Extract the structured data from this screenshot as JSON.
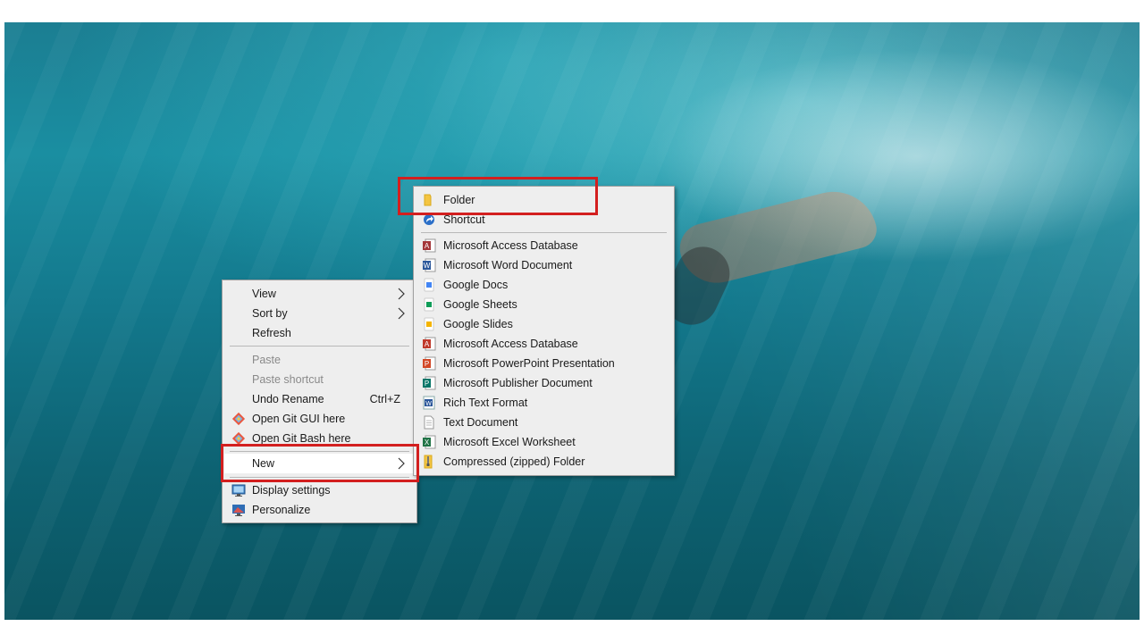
{
  "context_menu": {
    "items": [
      {
        "label": "View"
      },
      {
        "label": "Sort by"
      },
      {
        "label": "Refresh"
      },
      {
        "label": "Paste"
      },
      {
        "label": "Paste shortcut"
      },
      {
        "label": "Undo Rename",
        "shortcut": "Ctrl+Z"
      },
      {
        "label": "Open Git GUI here"
      },
      {
        "label": "Open Git Bash here"
      },
      {
        "label": "New"
      },
      {
        "label": "Display settings"
      },
      {
        "label": "Personalize"
      }
    ]
  },
  "new_submenu": {
    "items": [
      {
        "label": "Folder",
        "icon": "folder-icon"
      },
      {
        "label": "Shortcut",
        "icon": "shortcut-icon"
      },
      {
        "label": "Microsoft Access Database",
        "icon": "access-icon"
      },
      {
        "label": "Microsoft Word Document",
        "icon": "word-icon"
      },
      {
        "label": "Google Docs",
        "icon": "google-docs-icon"
      },
      {
        "label": "Google Sheets",
        "icon": "google-sheets-icon"
      },
      {
        "label": "Google Slides",
        "icon": "google-slides-icon"
      },
      {
        "label": "Microsoft Access Database",
        "icon": "access-icon"
      },
      {
        "label": "Microsoft PowerPoint Presentation",
        "icon": "powerpoint-icon"
      },
      {
        "label": "Microsoft Publisher Document",
        "icon": "publisher-icon"
      },
      {
        "label": "Rich Text Format",
        "icon": "rtf-icon"
      },
      {
        "label": "Text Document",
        "icon": "text-document-icon"
      },
      {
        "label": "Microsoft Excel Worksheet",
        "icon": "excel-icon"
      },
      {
        "label": "Compressed (zipped) Folder",
        "icon": "zip-folder-icon"
      }
    ]
  },
  "colors": {
    "menu_bg": "#eeeeee",
    "highlight_box": "#d31f1f",
    "desktop_water": "#13788c"
  }
}
